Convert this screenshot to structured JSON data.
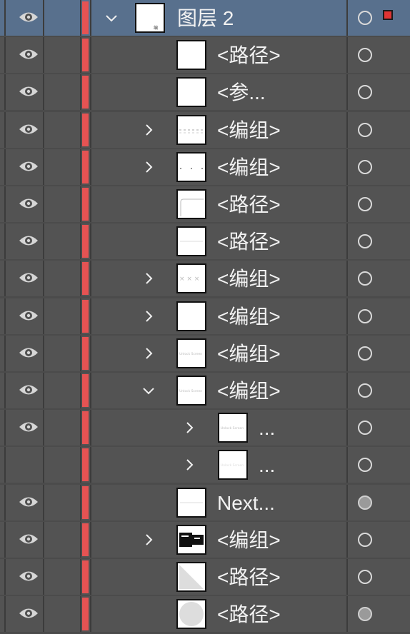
{
  "colors": {
    "panel_bg": "#4b4b4b",
    "row_bg": "#535353",
    "selected_row_bg": "#58708d",
    "layer_color": "#e55353",
    "selection_marker": "#e03434"
  },
  "layers": [
    {
      "label": "图层 2",
      "visible": true,
      "expand": "down",
      "indent": 0,
      "target": "empty",
      "selected": true,
      "thumb": "layer"
    },
    {
      "label": "<路径>",
      "visible": true,
      "expand": "none",
      "indent": 1,
      "target": "empty",
      "thumb": "blank"
    },
    {
      "label": "<参...",
      "visible": true,
      "expand": "none",
      "indent": 1,
      "target": "empty",
      "thumb": "blank"
    },
    {
      "label": "<编组>",
      "visible": true,
      "expand": "right",
      "indent": 1,
      "target": "empty",
      "thumb": "dashes"
    },
    {
      "label": "<编组>",
      "visible": true,
      "expand": "right",
      "indent": 1,
      "target": "empty",
      "thumb": "dots"
    },
    {
      "label": "<路径>",
      "visible": true,
      "expand": "none",
      "indent": 1,
      "target": "empty",
      "thumb": "corner"
    },
    {
      "label": "<路径>",
      "visible": true,
      "expand": "none",
      "indent": 1,
      "target": "empty",
      "thumb": "line"
    },
    {
      "label": "<编组>",
      "visible": true,
      "expand": "right",
      "indent": 1,
      "target": "empty",
      "thumb": "crosses"
    },
    {
      "label": "<编组>",
      "visible": true,
      "expand": "right",
      "indent": 1,
      "target": "empty",
      "thumb": "blank"
    },
    {
      "label": "<编组>",
      "visible": true,
      "expand": "right",
      "indent": 1,
      "target": "empty",
      "thumb": "text"
    },
    {
      "label": "<编组>",
      "visible": true,
      "expand": "down",
      "indent": 1,
      "target": "empty",
      "thumb": "text"
    },
    {
      "label": "...",
      "visible": true,
      "expand": "right",
      "indent": 2,
      "target": "empty",
      "thumb": "text"
    },
    {
      "label": "...",
      "visible": false,
      "expand": "right",
      "indent": 2,
      "target": "empty",
      "thumb": "faint"
    },
    {
      "label": "Next...",
      "visible": true,
      "expand": "none",
      "indent": 1,
      "target": "filled",
      "thumb": "line"
    },
    {
      "label": "<编组>",
      "visible": true,
      "expand": "right",
      "indent": 1,
      "target": "empty",
      "thumb": "dark"
    },
    {
      "label": "<路径>",
      "visible": true,
      "expand": "none",
      "indent": 1,
      "target": "empty",
      "thumb": "diagonal"
    },
    {
      "label": "<路径>",
      "visible": true,
      "expand": "none",
      "indent": 1,
      "target": "filled",
      "thumb": "circle"
    }
  ]
}
